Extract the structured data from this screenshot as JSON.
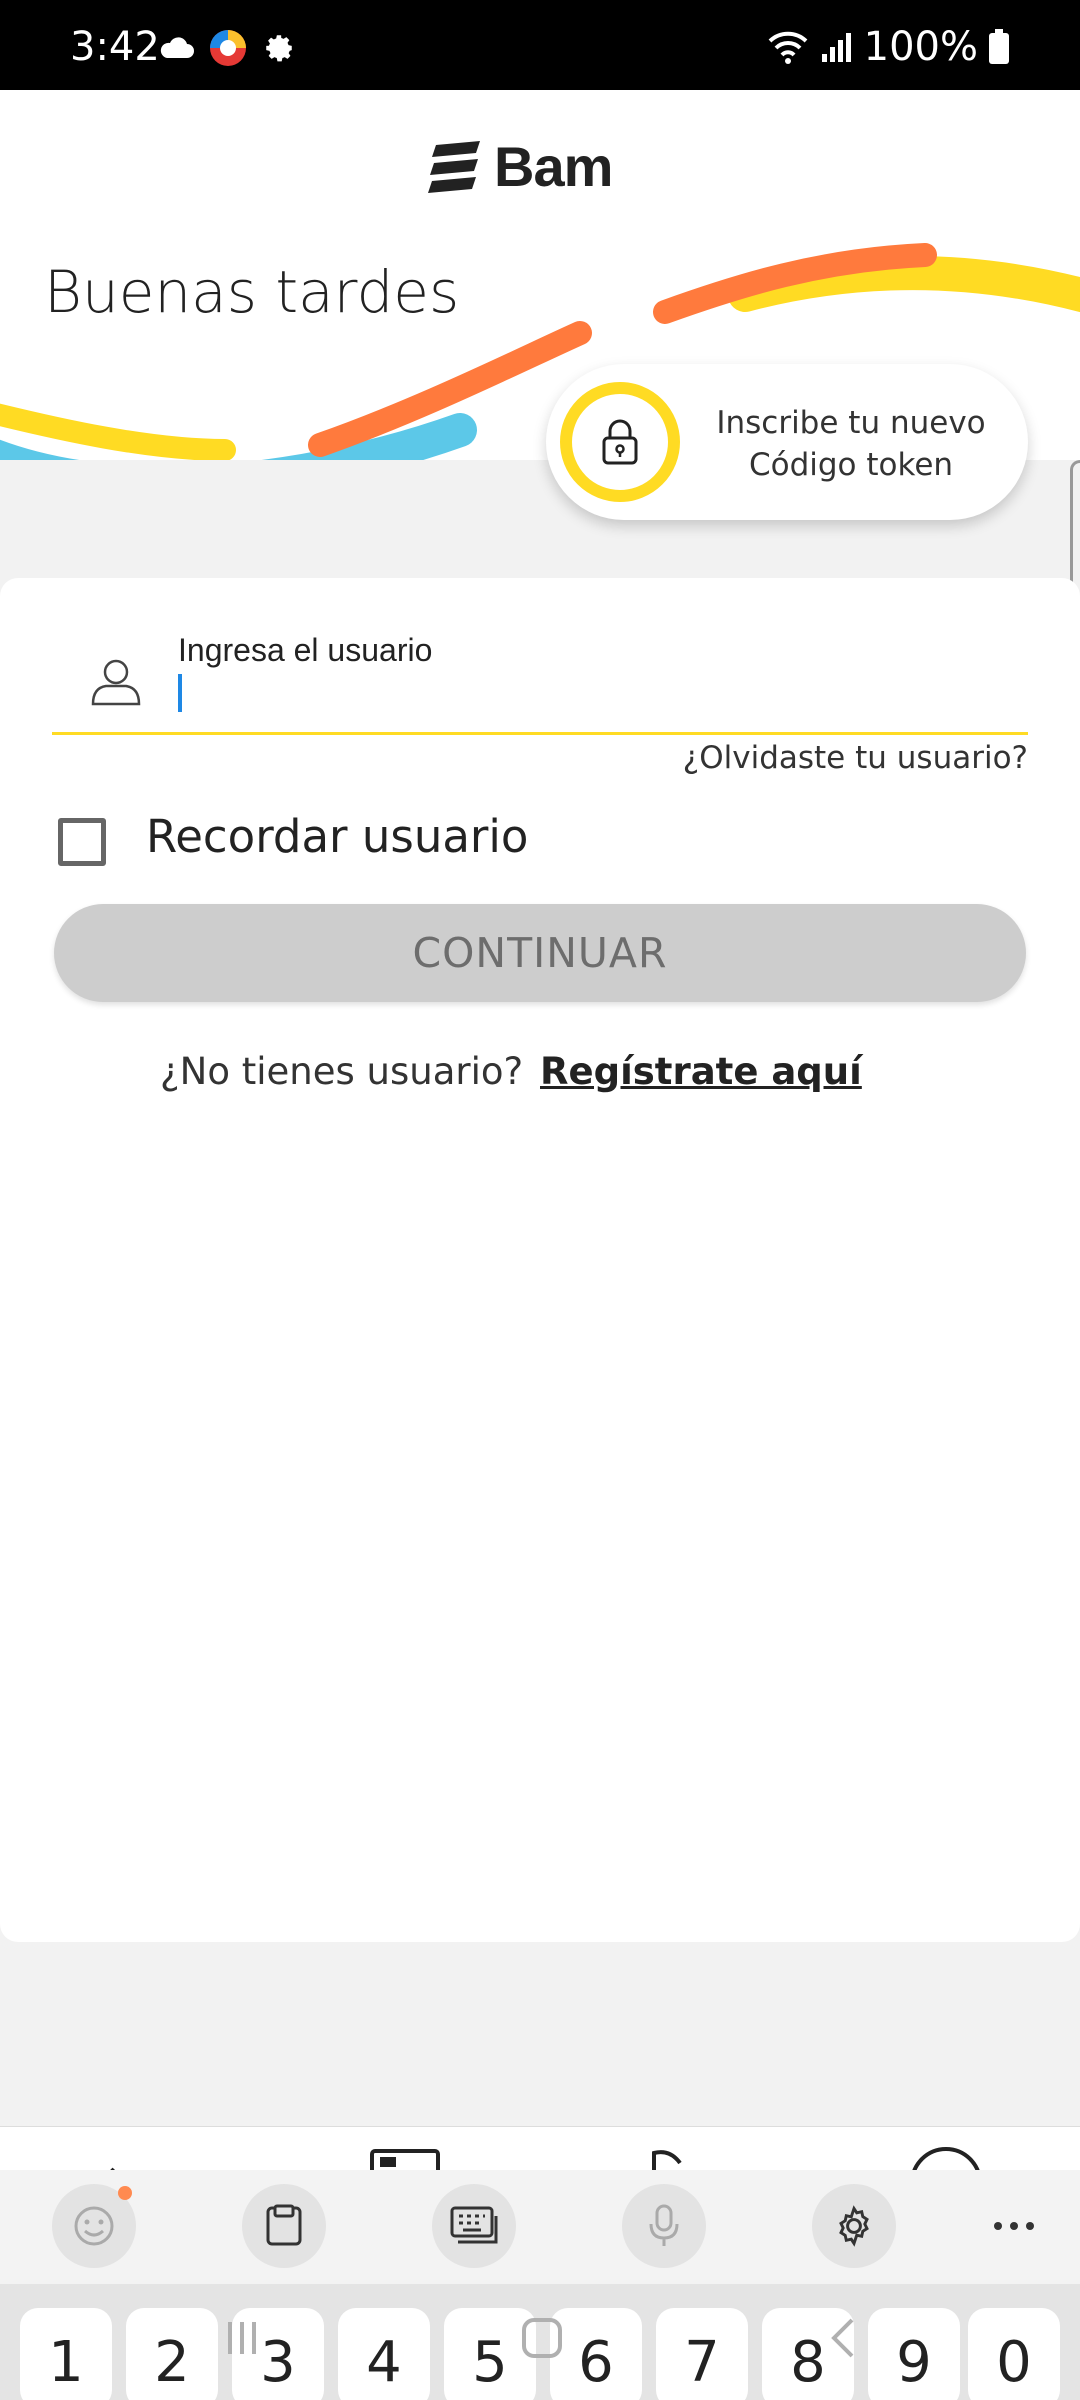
{
  "status_bar": {
    "time": "3:42",
    "battery": "100%",
    "left_icons": [
      "cloud-icon",
      "app-icon",
      "gear-icon"
    ],
    "right_icons": [
      "wifi-icon",
      "signal-icon",
      "battery-icon"
    ]
  },
  "brand": {
    "logo_text": "Bam",
    "colors": {
      "yellow": "#ffdb23",
      "orange": "#ff7a3d",
      "blue": "#5cc8e8"
    }
  },
  "header": {
    "greeting": "Buenas tardes",
    "token_card": {
      "line1": "Inscribe tu nuevo",
      "line2": "Código token",
      "icon": "lock-icon"
    }
  },
  "login": {
    "user_label": "Ingresa el usuario",
    "user_value": "",
    "forgot_user": "¿Olvidaste tu usuario?",
    "remember_label": "Recordar usuario",
    "remember_checked": false,
    "continue_label": "CONTINUAR",
    "no_account": "¿No tienes usuario?",
    "register_link": "Regístrate aquí"
  },
  "keyboard": {
    "toolbar": [
      "emoji-icon",
      "clipboard-icon",
      "keyboard-icon",
      "microphone-icon",
      "gear-icon",
      "more-icon"
    ],
    "number_keys": [
      "1",
      "2",
      "3",
      "4",
      "5",
      "6",
      "7",
      "8",
      "9",
      "0"
    ]
  }
}
